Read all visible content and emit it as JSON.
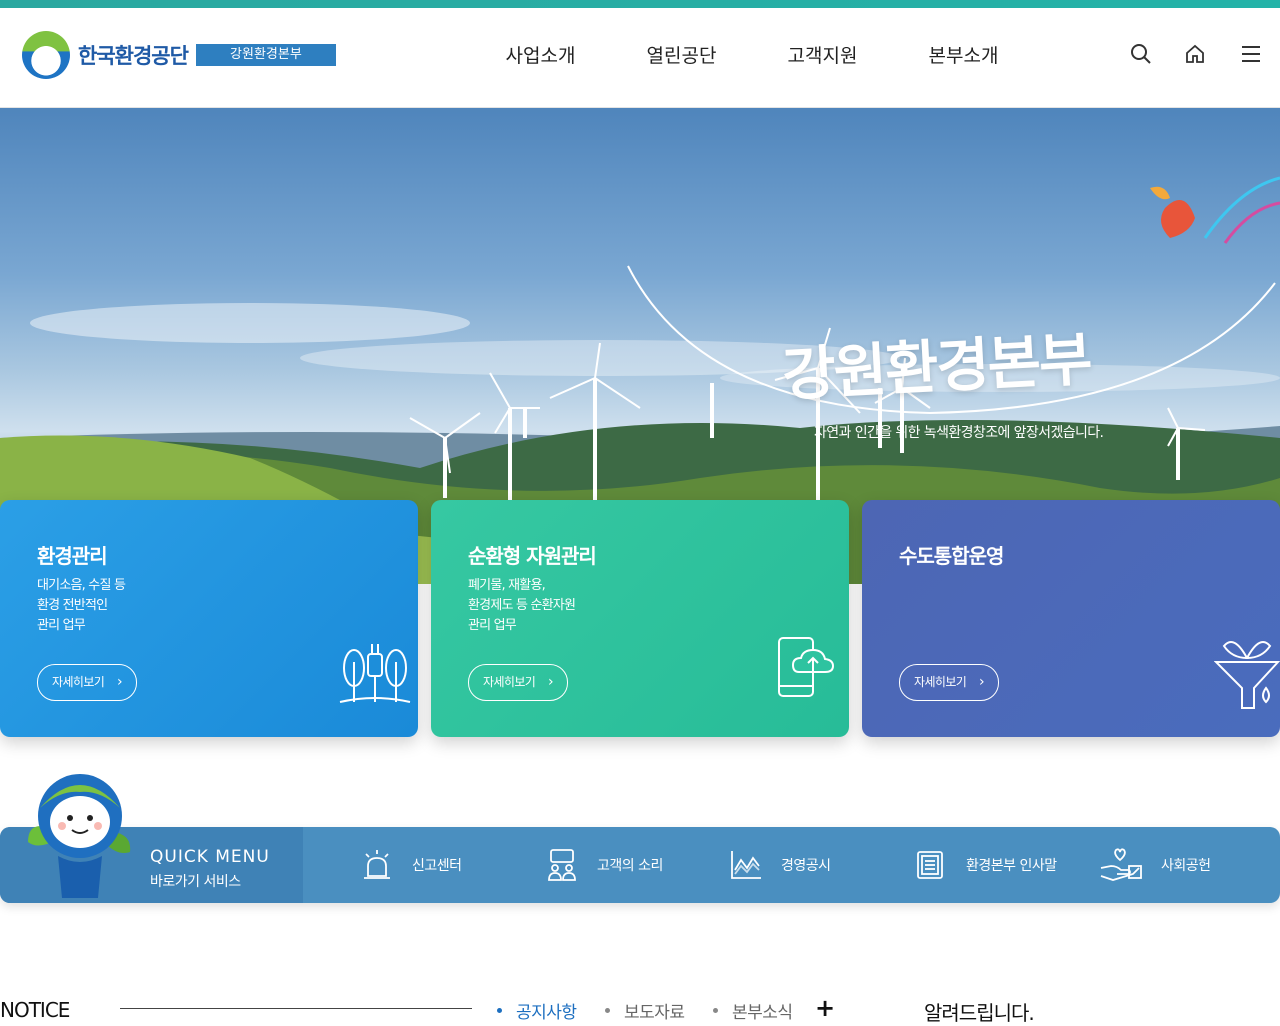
{
  "header": {
    "logo_text": "한국환경공단",
    "logo_sub": "강원환경본부",
    "nav": [
      "사업소개",
      "열린공단",
      "고객지원",
      "본부소개"
    ]
  },
  "hero": {
    "title": "강원환경본부",
    "subtitle": "자연과 인간을 위한 녹색환경창조에 앞장서겠습니다."
  },
  "cards": [
    {
      "title": "환경관리",
      "lines": [
        "대기소음, 수질 등",
        "환경 전반적인",
        "관리 업무"
      ],
      "more": "자세히보기",
      "color": "#2393df"
    },
    {
      "title": "순환형 자원관리",
      "lines": [
        "폐기물, 재활용,",
        "환경제도 등 순환자원",
        "관리 업무"
      ],
      "more": "자세히보기",
      "color": "#2ec3a0"
    },
    {
      "title": "수도통합운영",
      "lines": [],
      "more": "자세히보기",
      "color": "#4a68b8"
    }
  ],
  "quick_menu": {
    "title": "QUICK MENU",
    "subtitle": "바로가기 서비스",
    "items": [
      "신고센터",
      "고객의 소리",
      "경영공시",
      "환경본부 인사말",
      "사회공헌"
    ]
  },
  "notice": {
    "label": "NOTICE",
    "tabs": [
      "공지사항",
      "보도자료",
      "본부소식"
    ],
    "active_tab": "공지사항",
    "plus": "+",
    "inform": "알려드립니다."
  }
}
